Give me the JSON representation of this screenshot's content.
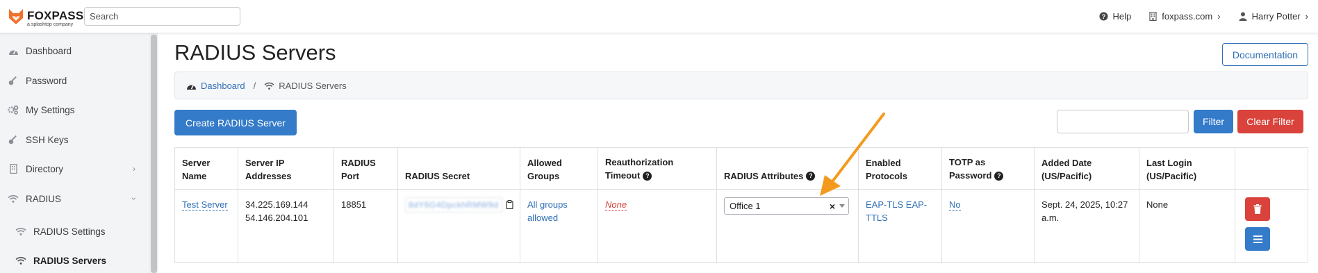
{
  "header": {
    "logo_text": "FOXPASS",
    "logo_sub": "a splashtop company",
    "search_placeholder": "Search",
    "help": "Help",
    "domain": "foxpass.com",
    "user": "Harry Potter"
  },
  "sidebar": {
    "items": [
      {
        "label": "Dashboard",
        "icon": "dashboard-icon"
      },
      {
        "label": "Password",
        "icon": "key-icon"
      },
      {
        "label": "My Settings",
        "icon": "gears-icon"
      },
      {
        "label": "SSH Keys",
        "icon": "key-icon"
      },
      {
        "label": "Directory",
        "icon": "building-icon"
      },
      {
        "label": "RADIUS",
        "icon": "wifi-icon"
      }
    ],
    "sub_items": [
      {
        "label": "RADIUS Settings",
        "icon": "wifi-icon"
      },
      {
        "label": "RADIUS Servers",
        "icon": "wifi-icon"
      }
    ]
  },
  "page": {
    "title": "RADIUS Servers",
    "documentation": "Documentation",
    "breadcrumb_home": "Dashboard",
    "breadcrumb_current": "RADIUS Servers",
    "create_button": "Create RADIUS Server",
    "filter_value": "",
    "filter_button": "Filter",
    "clear_filter_button": "Clear Filter"
  },
  "table": {
    "headers": {
      "server_name": "Server Name",
      "server_ip": "Server IP Addresses",
      "radius_port": "RADIUS Port",
      "radius_secret": "RADIUS Secret",
      "allowed_groups": "Allowed Groups",
      "reauth": "Reauthorization Timeout",
      "radius_attributes": "RADIUS Attributes",
      "enabled_protocols": "Enabled Protocols",
      "totp": "TOTP as Password",
      "added_date": "Added Date (US/Pacific)",
      "last_login": "Last Login (US/Pacific)"
    },
    "row": {
      "server_name": "Test Server",
      "ip1": "34.225.169.144",
      "ip2": "54.146.204.101",
      "port": "18851",
      "secret": "8dY6G4DpckhRMW9d",
      "allowed_groups": "All groups allowed",
      "reauth": "None",
      "radius_attribute": "Office 1",
      "protocols": "EAP-TLS EAP-TTLS",
      "totp": "No",
      "added_date": "Sept. 24, 2025, 10:27 a.m.",
      "last_login": "None"
    }
  },
  "colors": {
    "accent": "#347bc9",
    "danger": "#d9433b",
    "annotation_arrow": "#f39a1e"
  }
}
